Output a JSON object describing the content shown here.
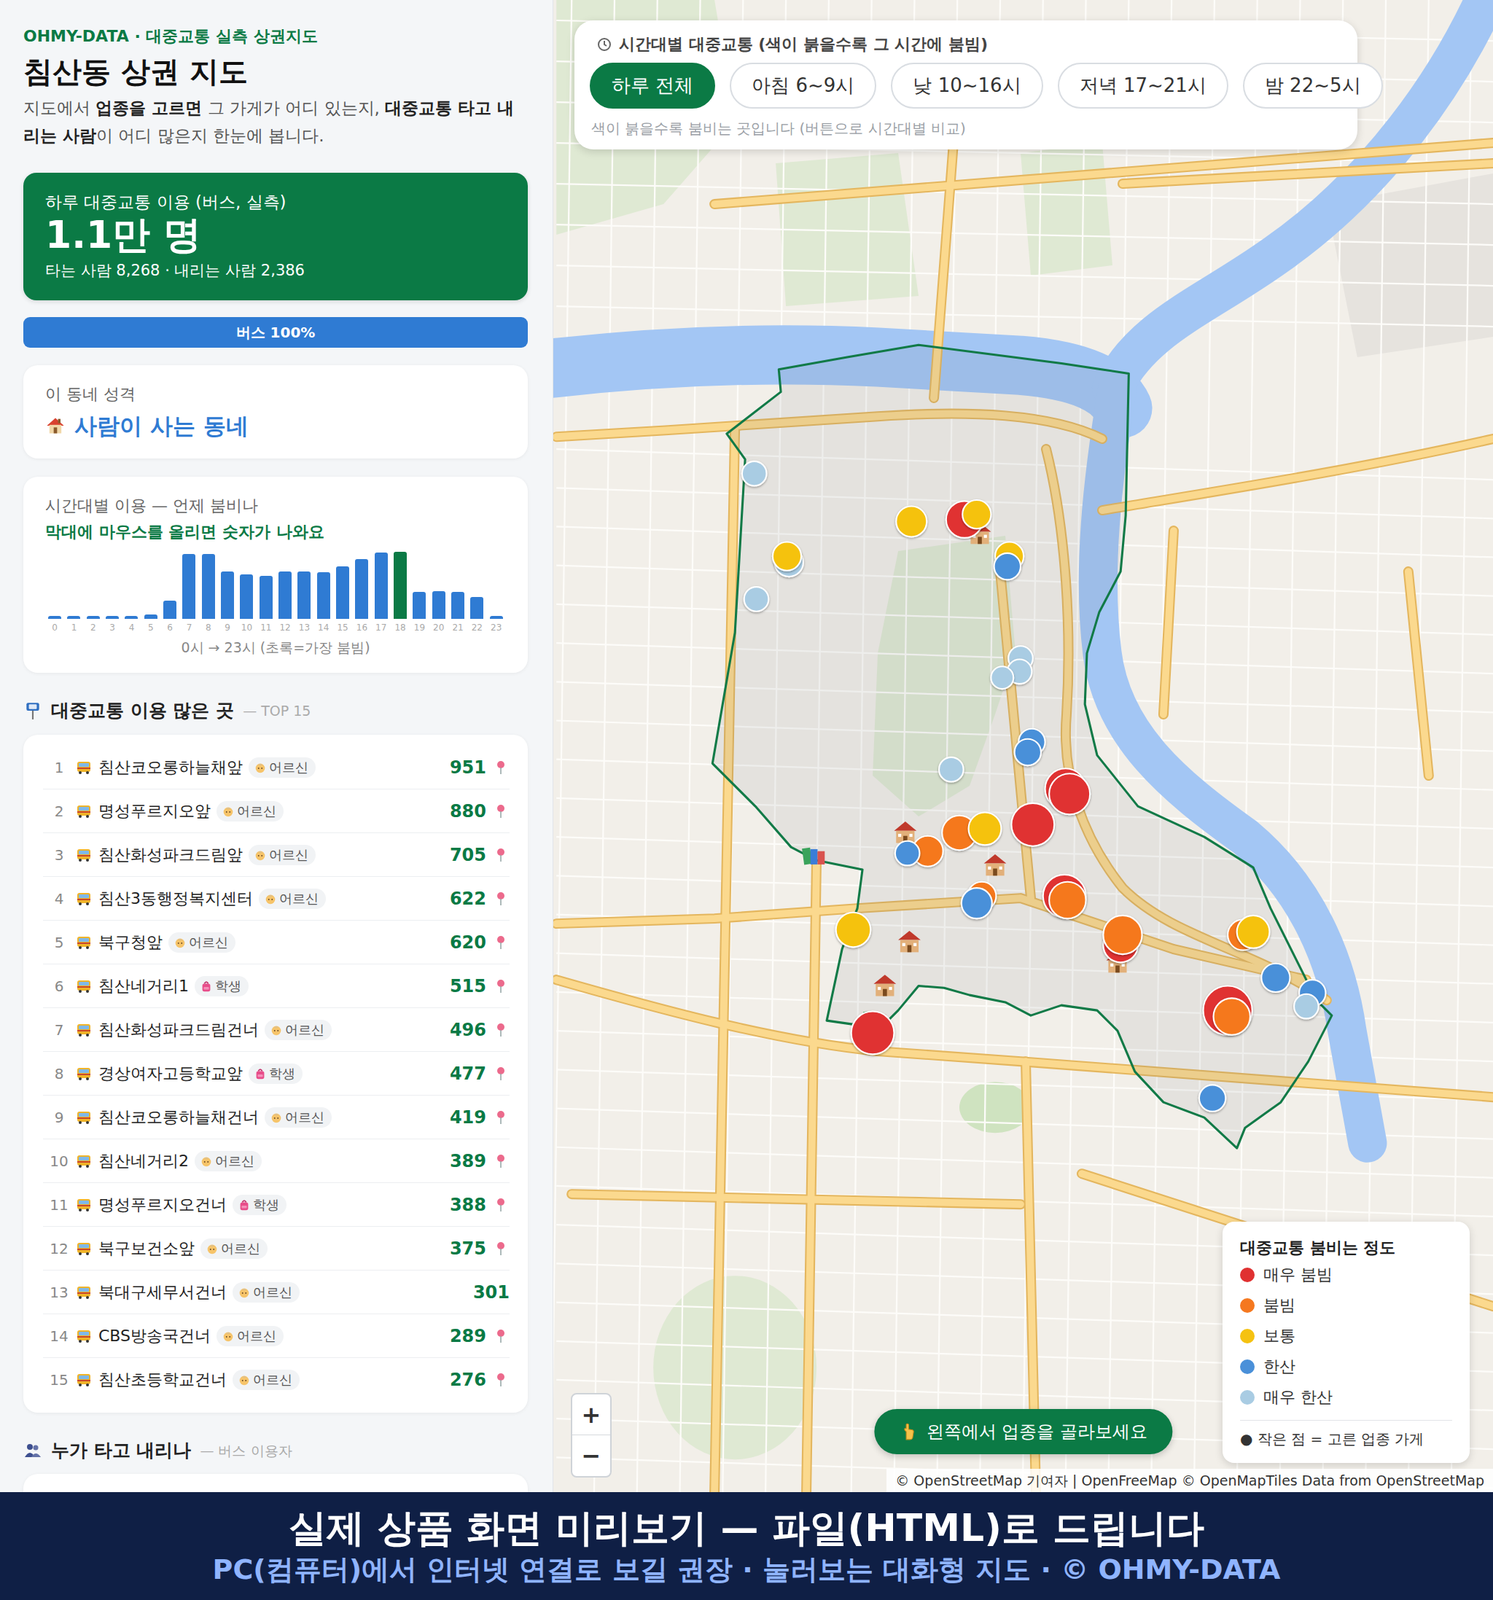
{
  "sidebar": {
    "brand": "OHMY-DATA · 대중교통 실측 상권지도",
    "title": "침산동 상권 지도",
    "description": [
      {
        "text": "지도에서 ",
        "bold": false
      },
      {
        "text": "업종을 고르면",
        "bold": true
      },
      {
        "text": " 그 가게가 어디 있는지, ",
        "bold": false
      },
      {
        "text": "대중교통 타고 내리는 사람",
        "bold": true
      },
      {
        "text": "이 어디 많은지 한눈에 봅니다.",
        "bold": false
      }
    ],
    "summary": {
      "label": "하루 대중교통 이용 (버스, 실측)",
      "value": "1.1만 명",
      "detail": "타는 사람 8,268 · 내리는 사람 2,386"
    },
    "mode_share": [
      {
        "label": "버스 100%",
        "level": 1.0
      }
    ],
    "character": {
      "label": "이 동네 성격",
      "value": "사람이 사는 동네"
    },
    "hourly_chart": {
      "title": "시간대별 이용 — 언제 붐비나",
      "hint": "막대에 마우스를 올리면 숫자가 나와요",
      "footer": "0시 → 23시 (초록=가장 붐빔)",
      "bars": [
        {
          "hour": "0",
          "value": 41,
          "peak": false
        },
        {
          "hour": "1",
          "value": 41,
          "peak": false
        },
        {
          "hour": "2",
          "value": 41,
          "peak": false
        },
        {
          "hour": "3",
          "value": 41,
          "peak": false
        },
        {
          "hour": "4",
          "value": 41,
          "peak": false
        },
        {
          "hour": "5",
          "value": 55,
          "peak": false
        },
        {
          "hour": "6",
          "value": 248,
          "peak": false
        },
        {
          "hour": "7",
          "value": 869,
          "peak": false
        },
        {
          "hour": "8",
          "value": 869,
          "peak": false
        },
        {
          "hour": "9",
          "value": 635,
          "peak": false
        },
        {
          "hour": "10",
          "value": 593,
          "peak": false
        },
        {
          "hour": "11",
          "value": 580,
          "peak": false
        },
        {
          "hour": "12",
          "value": 635,
          "peak": false
        },
        {
          "hour": "13",
          "value": 635,
          "peak": false
        },
        {
          "hour": "14",
          "value": 621,
          "peak": false
        },
        {
          "hour": "15",
          "value": 704,
          "peak": false
        },
        {
          "hour": "16",
          "value": 800,
          "peak": false
        },
        {
          "hour": "17",
          "value": 883,
          "peak": false
        },
        {
          "hour": "18",
          "value": 897,
          "peak": true
        },
        {
          "hour": "19",
          "value": 359,
          "peak": false
        },
        {
          "hour": "20",
          "value": 373,
          "peak": false
        },
        {
          "hour": "21",
          "value": 359,
          "peak": false
        },
        {
          "hour": "22",
          "value": 290,
          "peak": false
        },
        {
          "hour": "23",
          "value": 41,
          "peak": false
        }
      ]
    },
    "top_stops": {
      "title": "대중교통 이용 많은 곳",
      "subtitle": "— TOP 15",
      "rows": [
        {
          "rank": "1",
          "name": "침산코오롱하늘채앞",
          "tag": "어르신",
          "kind": "elder",
          "count": "951",
          "pinned": true
        },
        {
          "rank": "2",
          "name": "명성푸르지오앞",
          "tag": "어르신",
          "kind": "elder",
          "count": "880",
          "pinned": true
        },
        {
          "rank": "3",
          "name": "침산화성파크드림앞",
          "tag": "어르신",
          "kind": "elder",
          "count": "705",
          "pinned": true
        },
        {
          "rank": "4",
          "name": "침산3동행정복지센터",
          "tag": "어르신",
          "kind": "elder",
          "count": "622",
          "pinned": true
        },
        {
          "rank": "5",
          "name": "북구청앞",
          "tag": "어르신",
          "kind": "elder",
          "count": "620",
          "pinned": true
        },
        {
          "rank": "6",
          "name": "침산네거리1",
          "tag": "학생",
          "kind": "student",
          "count": "515",
          "pinned": true
        },
        {
          "rank": "7",
          "name": "침산화성파크드림건너",
          "tag": "어르신",
          "kind": "elder",
          "count": "496",
          "pinned": true
        },
        {
          "rank": "8",
          "name": "경상여자고등학교앞",
          "tag": "학생",
          "kind": "student",
          "count": "477",
          "pinned": true
        },
        {
          "rank": "9",
          "name": "침산코오롱하늘채건너",
          "tag": "어르신",
          "kind": "elder",
          "count": "419",
          "pinned": true
        },
        {
          "rank": "10",
          "name": "침산네거리2",
          "tag": "어르신",
          "kind": "elder",
          "count": "389",
          "pinned": true
        },
        {
          "rank": "11",
          "name": "명성푸르지오건너",
          "tag": "학생",
          "kind": "student",
          "count": "388",
          "pinned": true
        },
        {
          "rank": "12",
          "name": "북구보건소앞",
          "tag": "어르신",
          "kind": "elder",
          "count": "375",
          "pinned": true
        },
        {
          "rank": "13",
          "name": "북대구세무서건너",
          "tag": "어르신",
          "kind": "elder",
          "count": "301",
          "pinned": false
        },
        {
          "rank": "14",
          "name": "CBS방송국건너",
          "tag": "어르신",
          "kind": "elder",
          "count": "289",
          "pinned": true
        },
        {
          "rank": "15",
          "name": "침산초등학교건너",
          "tag": "어르신",
          "kind": "elder",
          "count": "276",
          "pinned": true
        }
      ]
    },
    "riders": {
      "title": "누가 타고 내리나",
      "subtitle": "— 버스 이용자"
    }
  },
  "map": {
    "time_filter": {
      "title": "시간대별 대중교통 (색이 붉을수록 그 시간에 붐빔)",
      "options": [
        {
          "label": "하루 전체",
          "selected": true
        },
        {
          "label": "아침 6~9시",
          "selected": false
        },
        {
          "label": "낮 10~16시",
          "selected": false
        },
        {
          "label": "저녁 17~21시",
          "selected": false
        },
        {
          "label": "밤 22~5시",
          "selected": false
        }
      ],
      "hint": "색이 붉을수록 붐비는 곳입니다 (버튼으로 시간대별 비교)"
    },
    "legend": {
      "title": "대중교통 붐비는 정도",
      "items": [
        {
          "label": "매우 붐빔",
          "color": "#e03131"
        },
        {
          "label": "붐빔",
          "color": "#f5781f"
        },
        {
          "label": "보통",
          "color": "#f5c211"
        },
        {
          "label": "한산",
          "color": "#4a90d9"
        },
        {
          "label": "매우 한산",
          "color": "#a9cce3"
        }
      ],
      "note": "● 작은 점 = 고른 업종 가게"
    },
    "zoom": {
      "in": "+",
      "out": "−"
    },
    "hint_button": "왼쪽에서 업종을 골라보세요",
    "attribution": "© OpenStreetMap 기여자 | OpenFreeMap © OpenMapTiles Data from OpenStreetMap",
    "stops": [
      {
        "color": "#a9cce3"
      },
      {
        "color": "#a9cce3"
      },
      {
        "color": "#f5c211"
      },
      {
        "color": "#a9cce3"
      },
      {
        "color": "#f5c211"
      },
      {
        "color": "#e03131"
      },
      {
        "color": "#f5c211"
      },
      {
        "color": "#f5c211"
      },
      {
        "color": "#4a90d9"
      },
      {
        "color": "#a9cce3"
      },
      {
        "color": "#a9cce3"
      },
      {
        "color": "#a9cce3"
      },
      {
        "color": "#4a90d9"
      },
      {
        "color": "#4a90d9"
      },
      {
        "color": "#a9cce3"
      },
      {
        "color": "#e03131"
      },
      {
        "color": "#e03131"
      },
      {
        "color": "#e03131"
      },
      {
        "color": "#f5781f"
      },
      {
        "color": "#f5c211"
      },
      {
        "color": "#f5781f"
      },
      {
        "color": "#4a90d9"
      },
      {
        "color": "#f5781f"
      },
      {
        "color": "#4a90d9"
      },
      {
        "color": "#e03131"
      },
      {
        "color": "#f5781f"
      },
      {
        "color": "#e03131"
      },
      {
        "color": "#f5781f"
      },
      {
        "color": "#f5c211"
      },
      {
        "color": "#e03131"
      },
      {
        "color": "#f5781f"
      },
      {
        "color": "#f5c211"
      },
      {
        "color": "#e03131"
      },
      {
        "color": "#f5781f"
      },
      {
        "color": "#4a90d9"
      },
      {
        "color": "#4a90d9"
      },
      {
        "color": "#a9cce3"
      },
      {
        "color": "#4a90d9"
      }
    ]
  },
  "banner": {
    "title": "실제 상품 화면 미리보기 — 파일(HTML)로 드립니다",
    "subtitle": "PC(컴퓨터)에서 인터넷 연결로 보길 권장 · 눌러보는 대화형 지도 · © OHMY-DATA"
  }
}
